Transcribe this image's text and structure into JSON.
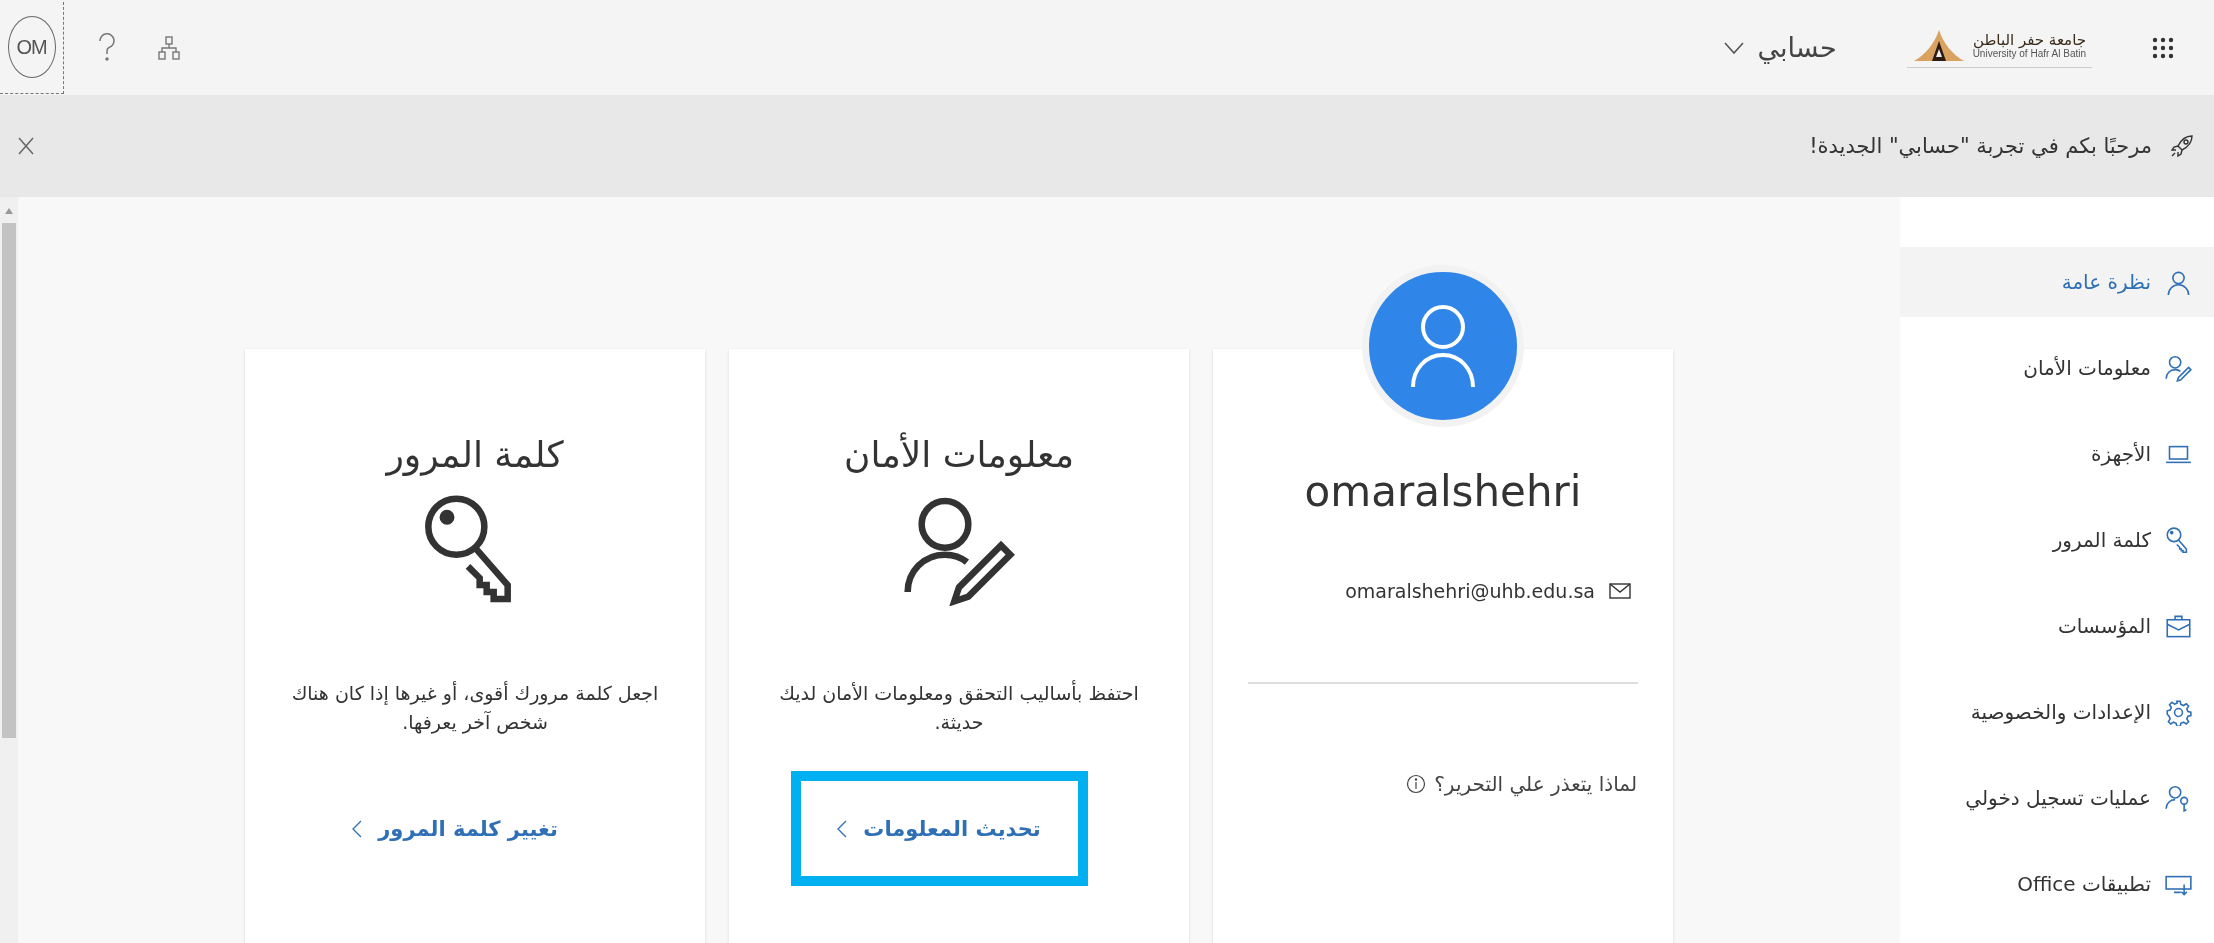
{
  "topbar": {
    "avatar_initials": "OM",
    "app_name": "حسابي",
    "logo": {
      "arabic": "جامعة حفر الباطن",
      "english": "University of Hafr Al Batin"
    }
  },
  "banner": {
    "message": "مرحبًا بكم في تجربة \"حسابي\" الجديدة!"
  },
  "sidebar": {
    "items": [
      {
        "label": "نظرة عامة",
        "kind": "person",
        "selected": true
      },
      {
        "label": "معلومات الأمان",
        "kind": "security",
        "selected": false
      },
      {
        "label": "الأجهزة",
        "kind": "devices",
        "selected": false
      },
      {
        "label": "كلمة المرور",
        "kind": "password",
        "selected": false
      },
      {
        "label": "المؤسسات",
        "kind": "organizations",
        "selected": false
      },
      {
        "label": "الإعدادات والخصوصية",
        "kind": "settings",
        "selected": false
      },
      {
        "label": "عمليات تسجيل دخولي",
        "kind": "signins",
        "selected": false
      },
      {
        "label": "تطبيقات Office",
        "kind": "apps",
        "selected": false
      }
    ]
  },
  "profile": {
    "name": "omaralshehri",
    "email": "omaralshehri@uhb.edu.sa",
    "edit_note": "لماذا يتعذر علي التحرير؟"
  },
  "cards": [
    {
      "title": "معلومات الأمان",
      "kind": "security",
      "description": "احتفظ بأساليب التحقق ومعلومات الأمان لديك حديثة.",
      "link": "تحديث المعلومات",
      "highlighted": true
    },
    {
      "title": "كلمة المرور",
      "kind": "password",
      "description": "اجعل كلمة مرورك أقوى، أو غيرها إذا كان هناك شخص آخر يعرفها.",
      "link": "تغيير كلمة المرور",
      "highlighted": false
    }
  ]
}
